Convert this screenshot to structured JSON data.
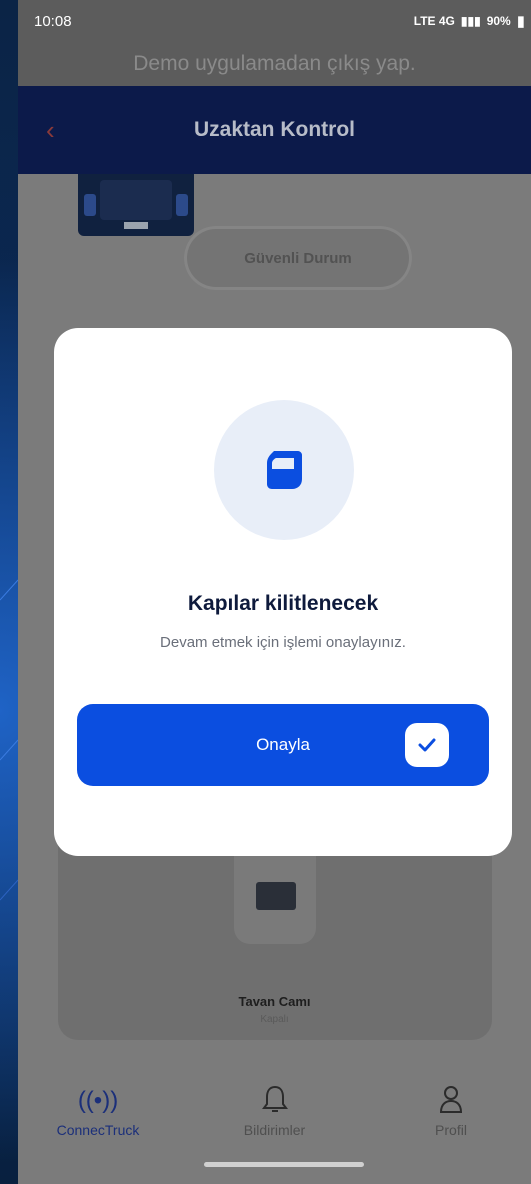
{
  "status_bar": {
    "time": "10:08",
    "network": "LTE 4G",
    "battery": "90%"
  },
  "demo_banner": "Demo uygulamadan çıkış yap.",
  "header": {
    "title": "Uzaktan Kontrol"
  },
  "background_content": {
    "status_pill": "Güvenli Durum",
    "roof": {
      "title": "Tavan Camı",
      "state": "Kapalı"
    }
  },
  "modal": {
    "icon": "door-icon",
    "title": "Kapılar kilitlenecek",
    "subtitle": "Devam etmek için işlemi onaylayınız.",
    "confirm_label": "Onayla"
  },
  "bottom_nav": {
    "tabs": [
      {
        "label": "ConnecTruck",
        "icon": "signal-icon",
        "active": true
      },
      {
        "label": "Bildirimler",
        "icon": "bell-icon",
        "active": false
      },
      {
        "label": "Profil",
        "icon": "user-icon",
        "active": false
      }
    ]
  },
  "colors": {
    "primary": "#0b4ee0",
    "navbar": "#0c1a4a",
    "title": "#0e1a3c"
  }
}
